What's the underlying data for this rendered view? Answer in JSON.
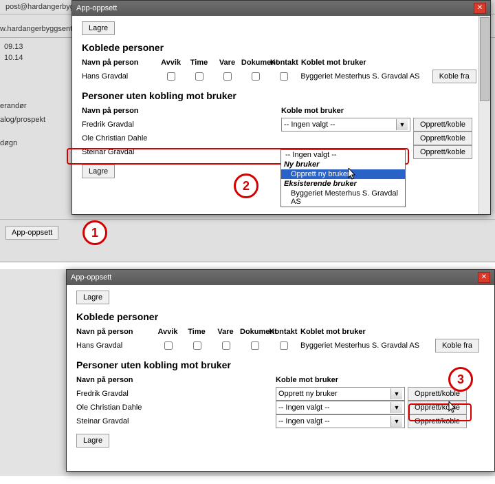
{
  "bg": {
    "email": "post@hardangerbyggsenter.no",
    "web": "w.hardangerbyggsenter",
    "date1": "09.13",
    "date2": "10.14",
    "side1": "erandør",
    "side2": "alog/prospekt",
    "side3": "døgn",
    "app_btn": "App-oppsett"
  },
  "modal": {
    "title": "App-oppsett",
    "save": "Lagre",
    "sec1": "Koblede personer",
    "sec2": "Personer uten kobling mot bruker",
    "h_name": "Navn på person",
    "h_avvik": "Avvik",
    "h_time": "Time",
    "h_vare": "Vare",
    "h_dok": "Dokument",
    "h_kontakt": "Kontakt",
    "h_koblet": "Koblet mot bruker",
    "h_koble_mot": "Koble mot bruker",
    "btn_koblefra": "Koble fra",
    "btn_opprett": "Opprett/koble",
    "linked": {
      "name": "Hans Gravdal",
      "koblet": "Byggeriet Mesterhus S. Gravdal AS"
    }
  },
  "dropdown": {
    "none": "-- Ingen valgt --",
    "ny_hdr": "Ny bruker",
    "opprett": "Opprett ny bruker",
    "eks_hdr": "Eksisterende bruker",
    "existing1": "Byggeriet Mesterhus S. Gravdal AS"
  },
  "top_unlinked": [
    "Fredrik Gravdal",
    "Ole Christian Dahle",
    "Steinar Gravdal"
  ],
  "bottom_unlinked": [
    {
      "name": "Fredrik Gravdal",
      "sel": "Opprett ny bruker"
    },
    {
      "name": "Ole Christian Dahle",
      "sel": "-- Ingen valgt --"
    },
    {
      "name": "Steinar Gravdal",
      "sel": "-- Ingen valgt --"
    }
  ],
  "callouts": {
    "c1": "1",
    "c2": "2",
    "c3": "3"
  }
}
